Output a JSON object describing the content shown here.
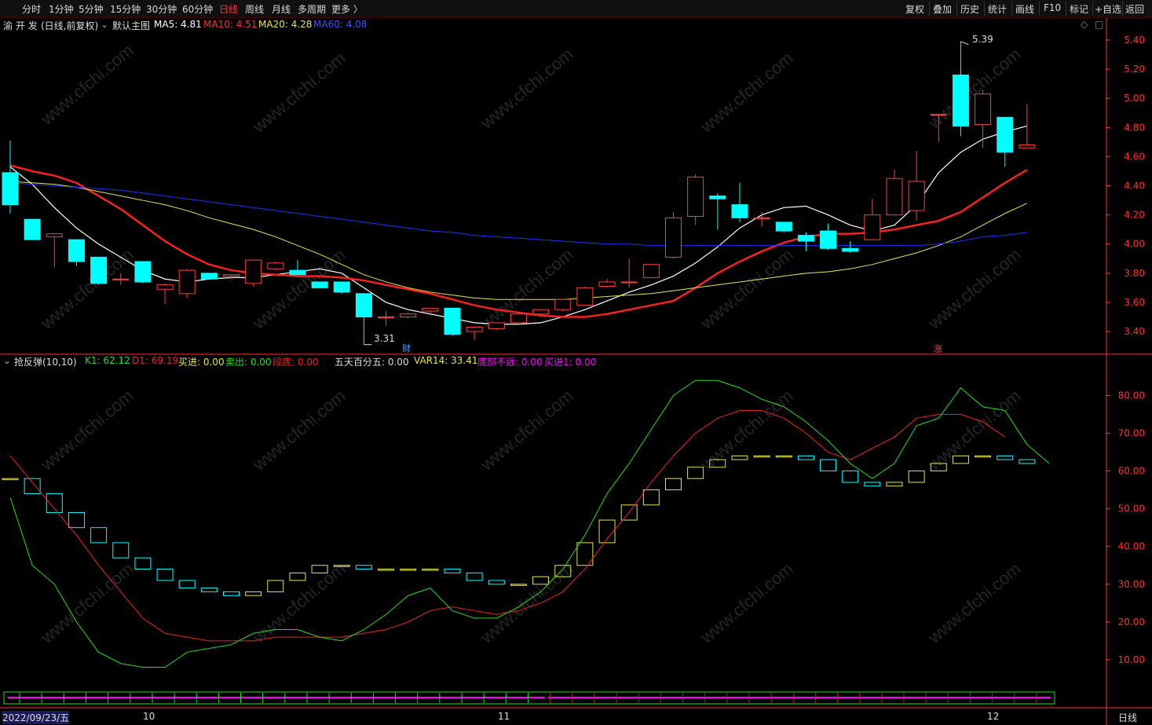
{
  "toolbar": {
    "periods": [
      "分时",
      "1分钟",
      "5分钟",
      "15分钟",
      "30分钟",
      "60分钟",
      "日线",
      "周线",
      "月线",
      "多周期",
      "更多 〉"
    ],
    "active_period": "日线",
    "tools": [
      "复权",
      "叠加",
      "历史",
      "统计",
      "画线",
      "F10",
      "标记",
      "+自选",
      "返回"
    ]
  },
  "main_info": {
    "stock_name": "渝 开 发",
    "mode": "(日线,前复权)",
    "indicator_name": "默认主图",
    "ma5_label": "MA5: 4.81",
    "ma10_label": "MA10: 4.51",
    "ma20_label": "MA20: 4.28",
    "ma60_label": "MA60: 4.08"
  },
  "sub_info": {
    "indicator_name": "抢反弹(10,10)",
    "k1_label": "K1: 62.12",
    "d1_label": "D1: 69.19",
    "buy_label": "买进: 0.00",
    "sell_label": "卖出: 0.00",
    "bottom_label": "段底: 0.00",
    "wtbf_label": "五天百分五: 0.00",
    "var14_label": "VAR14: 33.41",
    "near_bottom_label": "底部不远: 0.00",
    "buy1_label": "买进1: 0.00"
  },
  "annotations": {
    "high_label": "5.39",
    "low_label": "3.31",
    "fin_badge": "财",
    "limit_badge": "涨"
  },
  "date_axis": {
    "first_date": "2022/09/23/五",
    "month_labels": [
      "10",
      "11",
      "12"
    ]
  },
  "bottom_period": "日线",
  "colors": {
    "up": "#ff4040",
    "down": "#00ffff",
    "ma5": "#ffffff",
    "ma10": "#ff2020",
    "ma20": "#e6e64a",
    "ma60": "#2030ff",
    "k1": "#22dd22",
    "d1": "#ee2222",
    "var14": "#e6e64a",
    "near_bottom": "#ff00ff",
    "axis": "#ff3030"
  },
  "chart_data": [
    {
      "type": "candlestick",
      "title": "渝 开 发 (日线,前复权)",
      "y_ticks": [
        3.4,
        3.6,
        3.8,
        4.0,
        4.2,
        4.4,
        4.6,
        4.8,
        5.0,
        5.2,
        5.4
      ],
      "ylim": [
        3.26,
        5.47
      ],
      "candles": [
        [
          4.49,
          4.71,
          4.21,
          4.27
        ],
        [
          4.17,
          4.17,
          4.03,
          4.03
        ],
        [
          4.05,
          4.07,
          3.84,
          4.07
        ],
        [
          4.03,
          4.03,
          3.85,
          3.88
        ],
        [
          3.91,
          3.91,
          3.72,
          3.73
        ],
        [
          3.76,
          3.8,
          3.72,
          3.76
        ],
        [
          3.88,
          3.88,
          3.73,
          3.74
        ],
        [
          3.69,
          3.73,
          3.59,
          3.72
        ],
        [
          3.66,
          3.83,
          3.63,
          3.82
        ],
        [
          3.8,
          3.8,
          3.76,
          3.76
        ],
        [
          3.78,
          3.79,
          3.76,
          3.79
        ],
        [
          3.73,
          3.89,
          3.71,
          3.89
        ],
        [
          3.83,
          3.88,
          3.82,
          3.87
        ],
        [
          3.82,
          3.89,
          3.81,
          3.79
        ],
        [
          3.74,
          3.74,
          3.7,
          3.7
        ],
        [
          3.74,
          3.74,
          3.66,
          3.67
        ],
        [
          3.66,
          3.66,
          3.31,
          3.5
        ],
        [
          3.5,
          3.54,
          3.44,
          3.5
        ],
        [
          3.5,
          3.53,
          3.49,
          3.52
        ],
        [
          3.54,
          3.56,
          3.51,
          3.56
        ],
        [
          3.56,
          3.56,
          3.37,
          3.38
        ],
        [
          3.4,
          3.43,
          3.34,
          3.43
        ],
        [
          3.42,
          3.46,
          3.41,
          3.46
        ],
        [
          3.46,
          3.52,
          3.45,
          3.52
        ],
        [
          3.52,
          3.55,
          3.51,
          3.55
        ],
        [
          3.55,
          3.62,
          3.54,
          3.62
        ],
        [
          3.58,
          3.71,
          3.58,
          3.7
        ],
        [
          3.71,
          3.76,
          3.7,
          3.74
        ],
        [
          3.74,
          3.9,
          3.7,
          3.74
        ],
        [
          3.77,
          3.86,
          3.77,
          3.86
        ],
        [
          3.91,
          4.22,
          3.9,
          4.18
        ],
        [
          4.19,
          4.48,
          4.13,
          4.46
        ],
        [
          4.33,
          4.35,
          4.1,
          4.31
        ],
        [
          4.27,
          4.42,
          4.15,
          4.18
        ],
        [
          4.18,
          4.22,
          4.12,
          4.18
        ],
        [
          4.15,
          4.15,
          4.08,
          4.09
        ],
        [
          4.06,
          4.08,
          3.95,
          4.02
        ],
        [
          4.09,
          4.14,
          3.96,
          3.97
        ],
        [
          3.97,
          4.02,
          3.94,
          3.95
        ],
        [
          4.03,
          4.31,
          4.03,
          4.2
        ],
        [
          4.2,
          4.51,
          4.2,
          4.45
        ],
        [
          4.23,
          4.64,
          4.16,
          4.43
        ],
        [
          4.89,
          4.89,
          4.7,
          4.89
        ],
        [
          5.16,
          5.39,
          4.74,
          4.81
        ],
        [
          4.82,
          5.06,
          4.66,
          5.03
        ],
        [
          4.87,
          4.87,
          4.53,
          4.63
        ],
        [
          4.66,
          4.96,
          4.66,
          4.68
        ]
      ],
      "series": [
        {
          "name": "MA5",
          "values": [
            4.53,
            4.41,
            4.25,
            4.11,
            4.0,
            3.91,
            3.82,
            3.76,
            3.74,
            3.76,
            3.77,
            3.77,
            3.79,
            3.81,
            3.83,
            3.8,
            3.7,
            3.6,
            3.55,
            3.52,
            3.49,
            3.46,
            3.45,
            3.45,
            3.46,
            3.5,
            3.55,
            3.61,
            3.67,
            3.72,
            3.78,
            3.87,
            3.98,
            4.11,
            4.2,
            4.25,
            4.26,
            4.2,
            4.13,
            4.09,
            4.13,
            4.27,
            4.49,
            4.63,
            4.72,
            4.77,
            4.81
          ]
        },
        {
          "name": "MA10",
          "values": [
            4.54,
            4.5,
            4.47,
            4.42,
            4.33,
            4.24,
            4.13,
            4.02,
            3.93,
            3.86,
            3.82,
            3.8,
            3.79,
            3.78,
            3.78,
            3.77,
            3.75,
            3.72,
            3.69,
            3.66,
            3.62,
            3.58,
            3.55,
            3.53,
            3.51,
            3.5,
            3.5,
            3.52,
            3.55,
            3.58,
            3.61,
            3.7,
            3.8,
            3.88,
            3.95,
            4.01,
            4.05,
            4.07,
            4.07,
            4.08,
            4.1,
            4.13,
            4.16,
            4.22,
            4.32,
            4.42,
            4.51
          ]
        },
        {
          "name": "MA20",
          "values": [
            4.43,
            4.42,
            4.41,
            4.39,
            4.36,
            4.33,
            4.3,
            4.27,
            4.23,
            4.18,
            4.14,
            4.1,
            4.05,
            3.99,
            3.93,
            3.86,
            3.79,
            3.74,
            3.7,
            3.67,
            3.65,
            3.63,
            3.62,
            3.62,
            3.62,
            3.62,
            3.63,
            3.64,
            3.65,
            3.66,
            3.68,
            3.7,
            3.72,
            3.74,
            3.76,
            3.78,
            3.8,
            3.81,
            3.83,
            3.86,
            3.9,
            3.94,
            3.99,
            4.05,
            4.13,
            4.21,
            4.28
          ]
        },
        {
          "name": "MA60",
          "values": [
            4.42,
            4.41,
            4.4,
            4.39,
            4.38,
            4.37,
            4.35,
            4.33,
            4.31,
            4.29,
            4.27,
            4.25,
            4.23,
            4.21,
            4.19,
            4.17,
            4.15,
            4.13,
            4.11,
            4.09,
            4.08,
            4.06,
            4.05,
            4.04,
            4.03,
            4.02,
            4.01,
            4.0,
            4.0,
            3.99,
            3.99,
            3.99,
            3.99,
            3.99,
            3.99,
            3.99,
            3.99,
            3.99,
            3.99,
            3.99,
            3.99,
            3.99,
            4.0,
            4.02,
            4.05,
            4.06,
            4.08
          ]
        }
      ]
    },
    {
      "type": "line",
      "title": "抢反弹(10,10)",
      "y_ticks": [
        10,
        20,
        30,
        40,
        50,
        60,
        70,
        80
      ],
      "ylim": [
        0,
        88
      ],
      "series": [
        {
          "name": "K1",
          "values": [
            53,
            35,
            30,
            20,
            12,
            9,
            8,
            8,
            12,
            13,
            14,
            17,
            18,
            18,
            16,
            15,
            18,
            22,
            27,
            29,
            23,
            21,
            21,
            24,
            28,
            34,
            43,
            54,
            62,
            71,
            80,
            84,
            84,
            82,
            79,
            77,
            73,
            68,
            62,
            58,
            62,
            72,
            74,
            82,
            77,
            76,
            67,
            62
          ]
        },
        {
          "name": "D1",
          "values": [
            64,
            57,
            50,
            43,
            35,
            28,
            21,
            17,
            16,
            15,
            15,
            15,
            16,
            16,
            16,
            16,
            17,
            18,
            20,
            23,
            24,
            23,
            22,
            23,
            25,
            28,
            34,
            42,
            49,
            57,
            64,
            70,
            74,
            76,
            76,
            74,
            70,
            65,
            63,
            66,
            69,
            74,
            75,
            75,
            73,
            69
          ]
        },
        {
          "name": "VAR14",
          "values": [
            58,
            54,
            49,
            45,
            41,
            37,
            34,
            31,
            29,
            28,
            27,
            28,
            31,
            33,
            35,
            35,
            34,
            34,
            34,
            34,
            33,
            31,
            30,
            30,
            32,
            35,
            41,
            47,
            51,
            55,
            58,
            61,
            63,
            64,
            64,
            64,
            63,
            60,
            57,
            56,
            57,
            60,
            62,
            64,
            64,
            63,
            62
          ]
        }
      ]
    }
  ]
}
